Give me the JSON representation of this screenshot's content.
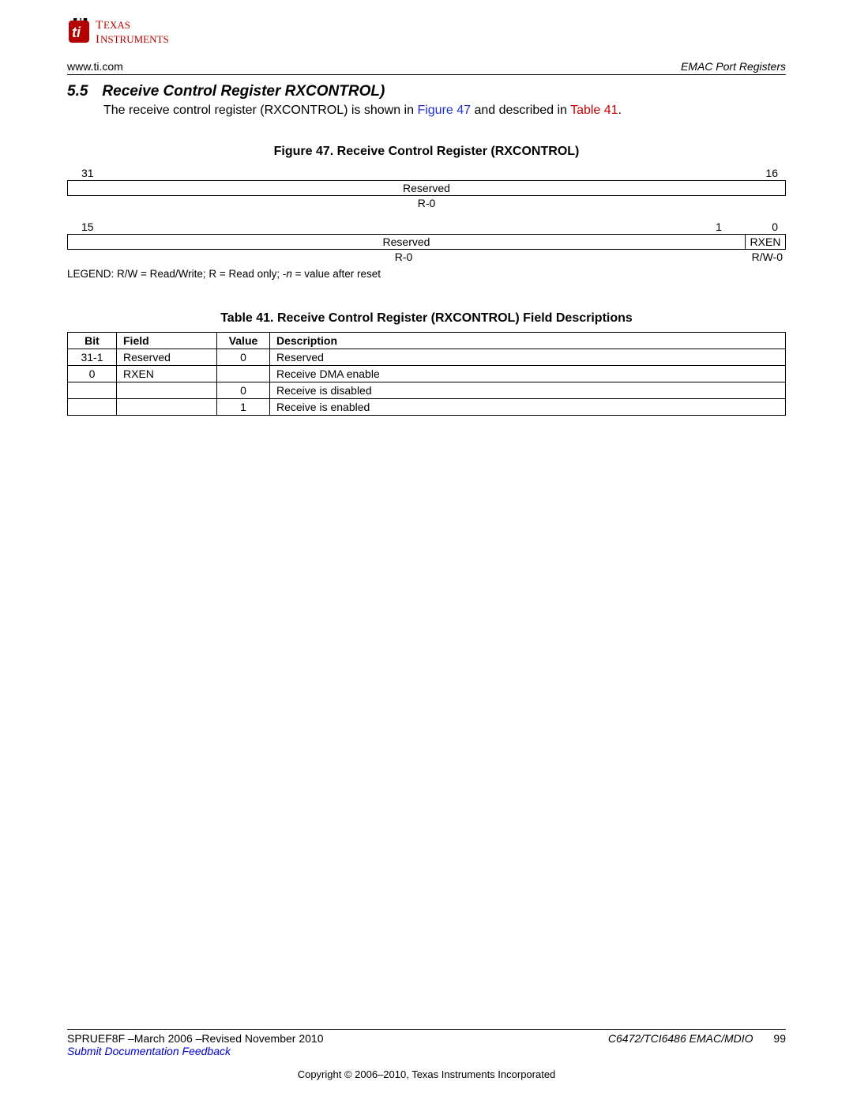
{
  "topbar": {
    "url": "www.ti.com",
    "section": "EMAC Port Registers"
  },
  "heading": {
    "num": "5.5",
    "title": "Receive Control Register RXCONTROL)"
  },
  "intro": {
    "t1": "The receive control register (RXCONTROL) is shown in ",
    "fig": "Figure 47",
    "t2": " and described in ",
    "tab": "Table 41",
    "t3": "."
  },
  "figure": {
    "caption": "Figure 47. Receive Control Register (RXCONTROL)",
    "b31": "31",
    "b16": "16",
    "resv": "Reserved",
    "r0": "R-0",
    "b15": "15",
    "b1": "1",
    "b0": "0",
    "rxen": "RXEN",
    "rw0": "R/W-0",
    "legend_a": "LEGEND: R/W = Read/Write; R = Read only; -",
    "legend_n": "n ",
    "legend_b": "= value after reset"
  },
  "table": {
    "caption": "Table 41. Receive Control Register (RXCONTROL) Field Descriptions",
    "hdr": {
      "bit": "Bit",
      "field": "Field",
      "value": "Value",
      "desc": "Description"
    },
    "r1": {
      "bit": "31-1",
      "field": "Reserved",
      "value": "0",
      "desc": "Reserved"
    },
    "r2": {
      "bit": "0",
      "field": "RXEN",
      "value": "",
      "desc": "Receive DMA enable"
    },
    "r3": {
      "value": "0",
      "desc": "Receive is disabled"
    },
    "r4": {
      "value": "1",
      "desc": "Receive is enabled"
    }
  },
  "footer": {
    "left": "SPRUEF8F –March 2006 –Revised November 2010",
    "doc": "C6472/TCI6486 EMAC/MDIO",
    "page": "99",
    "link": "Submit Documentation Feedback",
    "copyright": "Copyright © 2006–2010, Texas Instruments Incorporated"
  }
}
